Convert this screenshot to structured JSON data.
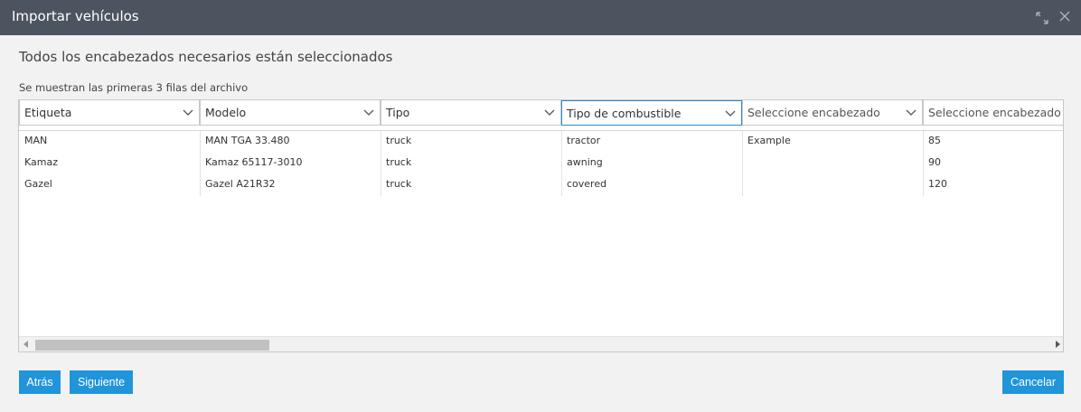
{
  "window": {
    "title": "Importar vehículos"
  },
  "status": {
    "heading": "Todos los encabezados necesarios están seleccionados",
    "subheading": "Se muestran las primeras 3 filas del archivo"
  },
  "columns": [
    {
      "label": "Etiqueta",
      "placeholder": false
    },
    {
      "label": "Modelo",
      "placeholder": false
    },
    {
      "label": "Tipo",
      "placeholder": false
    },
    {
      "label": "Tipo de combustible",
      "placeholder": false,
      "active": true
    },
    {
      "label": "Seleccione encabezado",
      "placeholder": true
    },
    {
      "label": "Seleccione encabezado",
      "placeholder": true
    }
  ],
  "rows": [
    [
      "MAN",
      "MAN TGA 33.480",
      "truck",
      "tractor",
      "Example",
      "85"
    ],
    [
      "Kamaz",
      "Kamaz 65117-3010",
      "truck",
      "awning",
      "",
      "90"
    ],
    [
      "Gazel",
      "Gazel A21R32",
      "truck",
      "covered",
      "",
      "120"
    ]
  ],
  "buttons": {
    "back": "Atrás",
    "next": "Siguiente",
    "cancel": "Cancelar"
  },
  "icons": {
    "expand": "expand-icon",
    "close": "close-icon",
    "chevron": "chevron-down-icon"
  }
}
